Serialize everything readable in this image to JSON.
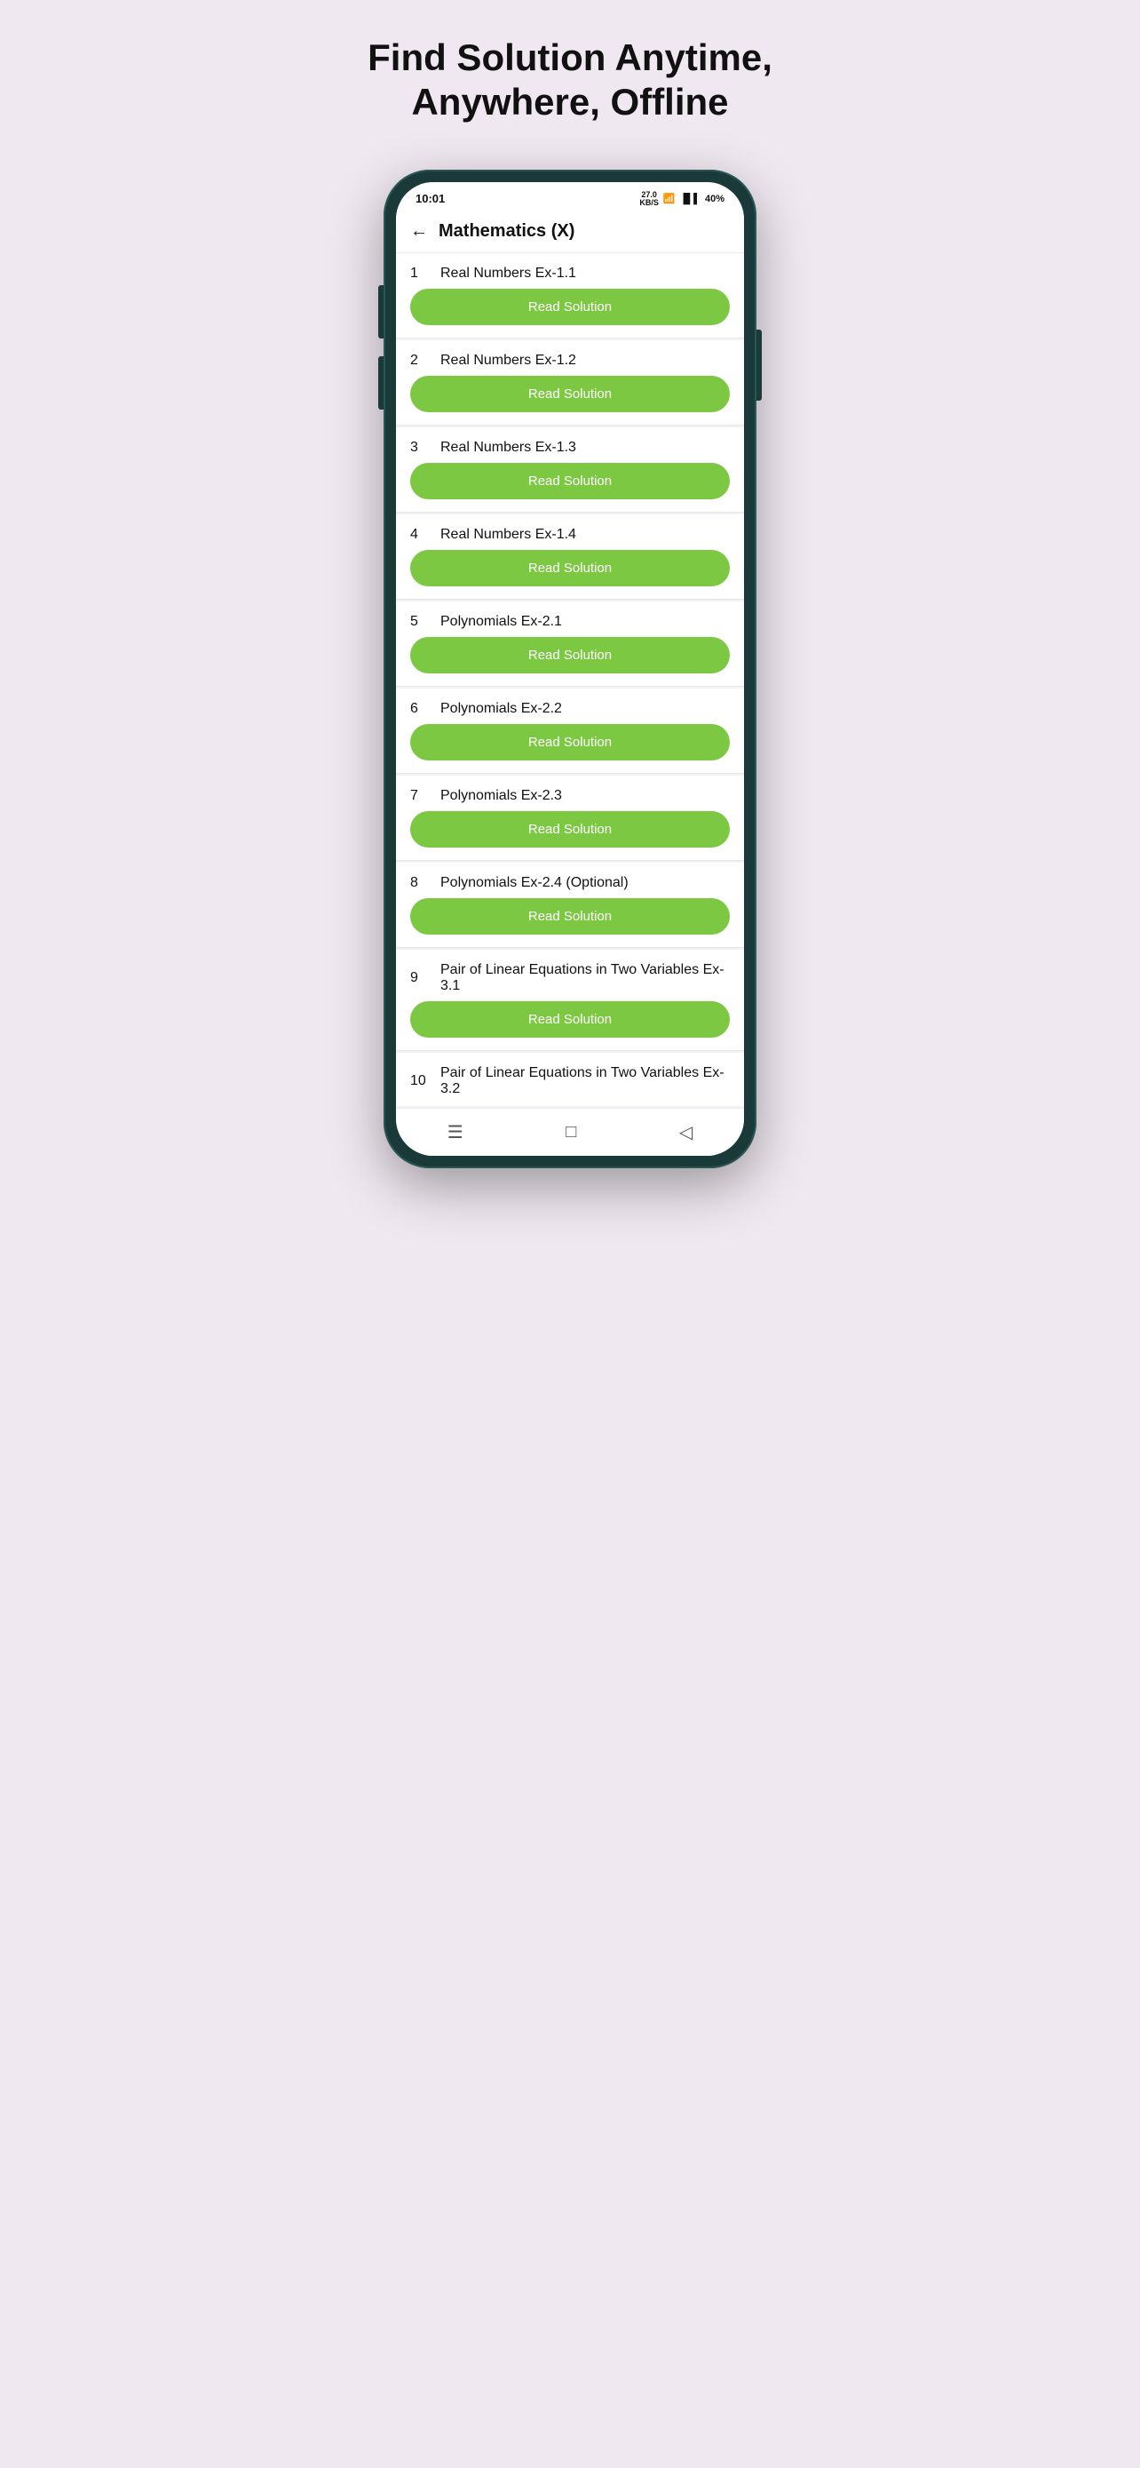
{
  "page": {
    "title_line1": "Find Solution Anytime,",
    "title_line2": "Anywhere, Offline"
  },
  "status_bar": {
    "time": "10:01",
    "data_speed": "27.0",
    "data_unit": "KB/S",
    "battery": "40%"
  },
  "header": {
    "title": "Mathematics (X)",
    "back_label": "←"
  },
  "read_btn_label": "Read Solution",
  "items": [
    {
      "number": "1",
      "title": "Real Numbers Ex-1.1"
    },
    {
      "number": "2",
      "title": "Real Numbers Ex-1.2"
    },
    {
      "number": "3",
      "title": "Real Numbers Ex-1.3"
    },
    {
      "number": "4",
      "title": "Real Numbers Ex-1.4"
    },
    {
      "number": "5",
      "title": "Polynomials Ex-2.1"
    },
    {
      "number": "6",
      "title": "Polynomials Ex-2.2"
    },
    {
      "number": "7",
      "title": "Polynomials Ex-2.3"
    },
    {
      "number": "8",
      "title": "Polynomials Ex-2.4 (Optional)"
    },
    {
      "number": "9",
      "title": "Pair of Linear Equations in Two Variables Ex-3.1"
    },
    {
      "number": "10",
      "title": "Pair of Linear Equations in Two Variables Ex-3.2",
      "last": true
    }
  ],
  "nav_bar": {
    "menu_icon": "☰",
    "home_icon": "□",
    "back_icon": "◁"
  },
  "colors": {
    "button_green": "#7dc842",
    "bg_lavender": "#f0e8f0",
    "phone_dark": "#1a3a3a"
  }
}
